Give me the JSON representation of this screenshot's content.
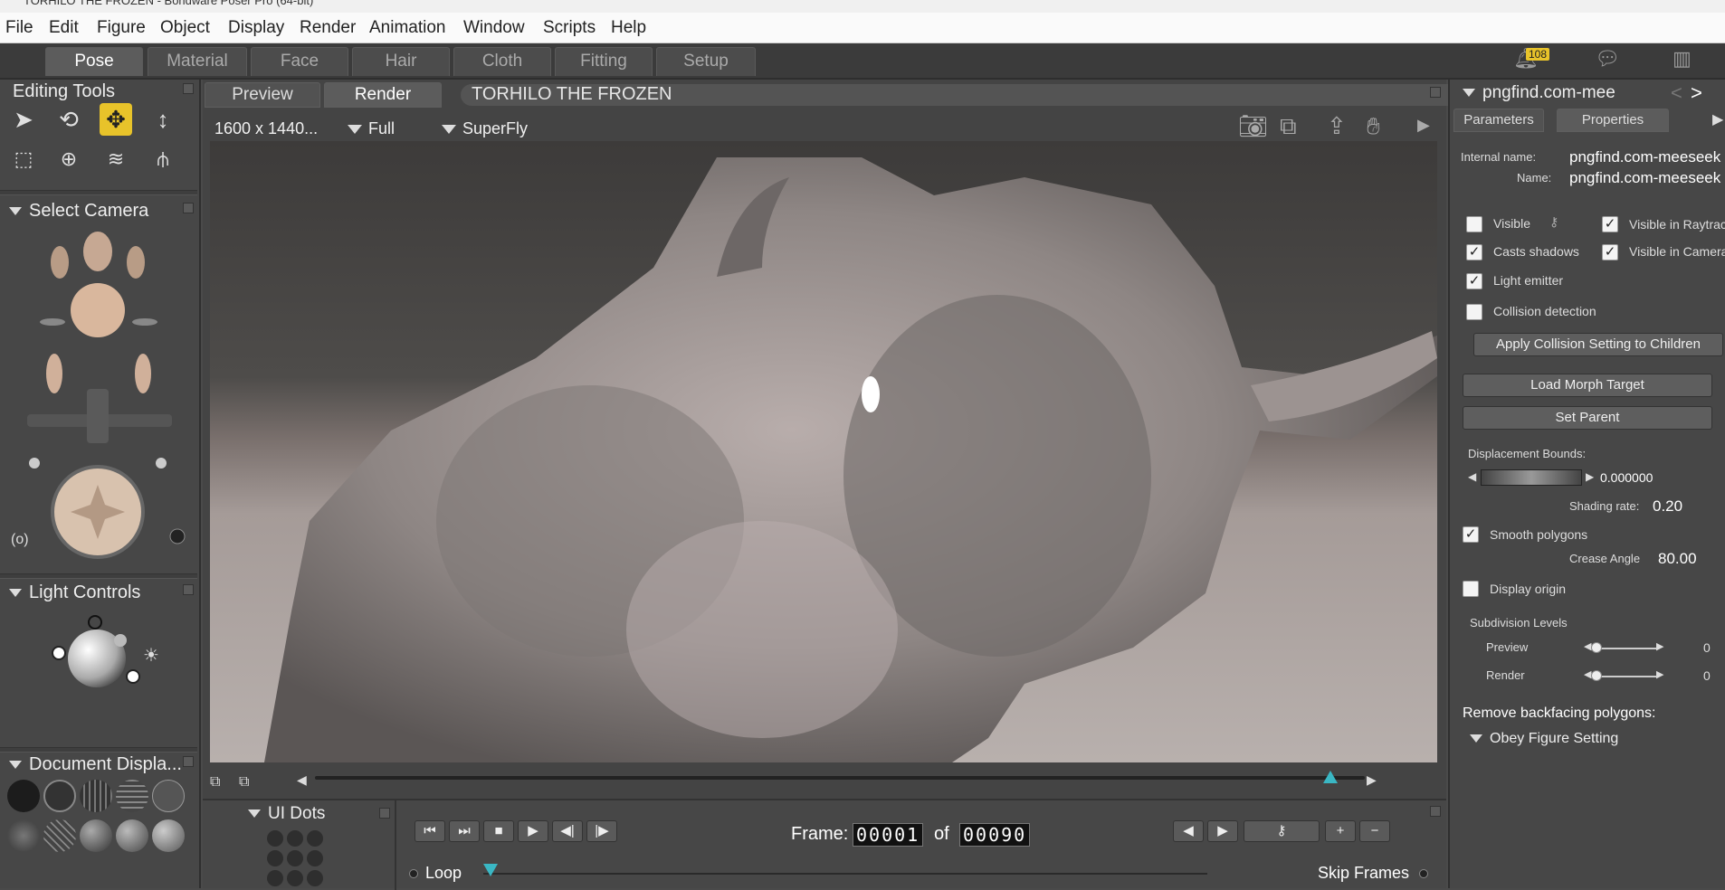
{
  "window": {
    "title": "TORHILO THE FROZEN - Bondware Poser Pro  (64-bit)"
  },
  "menu": [
    "File",
    "Edit",
    "Figure",
    "Object",
    "Display",
    "Render",
    "Animation",
    "Window",
    "Scripts",
    "Help"
  ],
  "rooms": [
    {
      "label": "Pose",
      "active": true
    },
    {
      "label": "Material"
    },
    {
      "label": "Face"
    },
    {
      "label": "Hair"
    },
    {
      "label": "Cloth"
    },
    {
      "label": "Fitting"
    },
    {
      "label": "Setup"
    }
  ],
  "notifications": {
    "count": "108"
  },
  "left": {
    "editing_tools": "Editing Tools",
    "select_camera": "Select Camera",
    "light_controls": "Light Controls",
    "document_display": "Document  Displa..."
  },
  "viewport": {
    "tabs": [
      "Preview",
      "Render"
    ],
    "scene_title": "TORHILO THE FROZEN",
    "resolution": "1600 x 1440...",
    "quality": "Full",
    "renderer": "SuperFly"
  },
  "playback": {
    "ui_dots": "UI Dots",
    "frame_label": "Frame:",
    "frame_current": "00001",
    "of_label": "of",
    "frame_total": "00090",
    "loop": "Loop",
    "skip_frames": "Skip Frames"
  },
  "props": {
    "object_name": "pngfind.com-mee",
    "tabs": [
      "Parameters",
      "Properties"
    ],
    "internal_name_label": "Internal name:",
    "internal_name": "pngfind.com-meeseek",
    "name_label": "Name:",
    "name": "pngfind.com-meeseek",
    "visible": "Visible",
    "visible_raytrace": "Visible in Raytrac",
    "casts_shadows": "Casts shadows",
    "visible_camera": "Visible in Camera",
    "light_emitter": "Light emitter",
    "collision_detection": "Collision detection",
    "apply_collision": "Apply Collision Setting to Children",
    "load_morph": "Load Morph Target",
    "set_parent": "Set Parent",
    "displacement_label": "Displacement Bounds:",
    "displacement_value": "0.000000",
    "shading_label": "Shading rate:",
    "shading_value": "0.20",
    "smooth_polygons": "Smooth polygons",
    "crease_label": "Crease Angle",
    "crease_value": "80.00",
    "display_origin": "Display origin",
    "subdivision_label": "Subdivision Levels",
    "preview_label": "Preview",
    "preview_value": "0",
    "render_label": "Render",
    "render_value": "0",
    "backfacing_label": "Remove backfacing polygons:",
    "obey_figure": "Obey Figure Setting"
  }
}
